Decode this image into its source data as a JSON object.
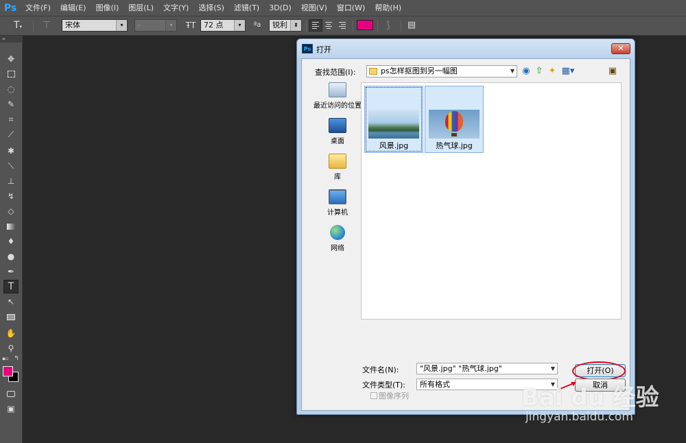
{
  "menubar": {
    "app": "Ps",
    "items": [
      "文件(F)",
      "编辑(E)",
      "图像(I)",
      "图层(L)",
      "文字(Y)",
      "选择(S)",
      "滤镜(T)",
      "3D(D)",
      "视图(V)",
      "窗口(W)",
      "帮助(H)"
    ]
  },
  "options": {
    "tool_glyph": "T",
    "font_family": "宋体",
    "font_style": "-",
    "font_size": "72 点",
    "aa_prefix": "ªa",
    "antialias": "锐利",
    "color": "#e6007e"
  },
  "toolbox": {
    "fg_color": "#e6007e",
    "bg_color": "#000000"
  },
  "dialog": {
    "title": "打开",
    "close": "✕",
    "look_in_label": "查找范围(I):",
    "look_in_value": "ps怎样抠图到另一幅图",
    "places": [
      "最近访问的位置",
      "桌面",
      "库",
      "计算机",
      "网络"
    ],
    "files": [
      "风景.jpg",
      "热气球.jpg"
    ],
    "filename_label": "文件名(N):",
    "filename_value": "\"风景.jpg\" \"热气球.jpg\"",
    "filetype_label": "文件类型(T):",
    "filetype_value": "所有格式",
    "open_button": "打开(O)",
    "cancel_button": "取消",
    "image_sequence": "图像序列"
  },
  "watermark": {
    "brand": "Bai du 经验",
    "url": "jingyan.baidu.com"
  }
}
